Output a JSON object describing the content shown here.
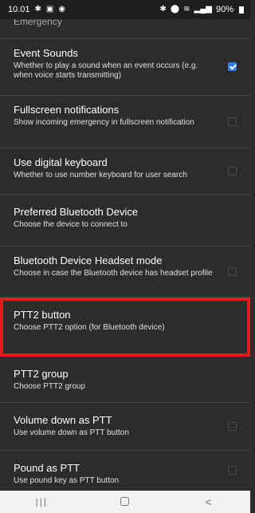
{
  "status_bar": {
    "time": "10.01",
    "battery": "90%",
    "icons": [
      "bluetooth-icon",
      "image-icon",
      "notification-icon",
      "bluetooth-icon",
      "location-icon",
      "wifi-icon",
      "signal-icon",
      "battery-icon"
    ]
  },
  "settings": {
    "cut_off_text": "Emergency",
    "items": [
      {
        "title": "Event Sounds",
        "summary": "Whether to play a sound when an event occurs (e.g. when voice starts transmitting)",
        "checkbox": true,
        "checked": true
      },
      {
        "title": "Fullscreen notifications",
        "summary": "Show incoming emergency in fullscreen notification",
        "checkbox": true,
        "checked": false
      },
      {
        "title": "Use digital keyboard",
        "summary": "Whether to use number keyboard for user search",
        "checkbox": true,
        "checked": false
      },
      {
        "title": "Preferred Bluetooth Device",
        "summary": "Choose the device to connect to",
        "checkbox": false,
        "checked": false
      },
      {
        "title": "Bluetooth Device Headset mode",
        "summary": "Choose in case the Bluetooth device has headset profile",
        "checkbox": true,
        "checked": false
      },
      {
        "title": "PTT2 button",
        "summary": "Choose PTT2 option (for Bluetooth device)",
        "checkbox": false,
        "checked": false,
        "highlighted": true
      },
      {
        "title": "PTT2 group",
        "summary": "Choose PTT2 group",
        "checkbox": false,
        "checked": false
      },
      {
        "title": "Volume down as PTT",
        "summary": "Use volume down as PTT button",
        "checkbox": true,
        "checked": false
      },
      {
        "title": "Pound as PTT",
        "summary": "Use pound key as PTT button",
        "checkbox": true,
        "checked": false
      }
    ]
  },
  "nav_bar": {
    "recents": "|||",
    "home": "",
    "back": "<"
  },
  "colors": {
    "background": "#2c2c2c",
    "accent": "#2a7fe0",
    "highlight": "#e31b1b"
  }
}
